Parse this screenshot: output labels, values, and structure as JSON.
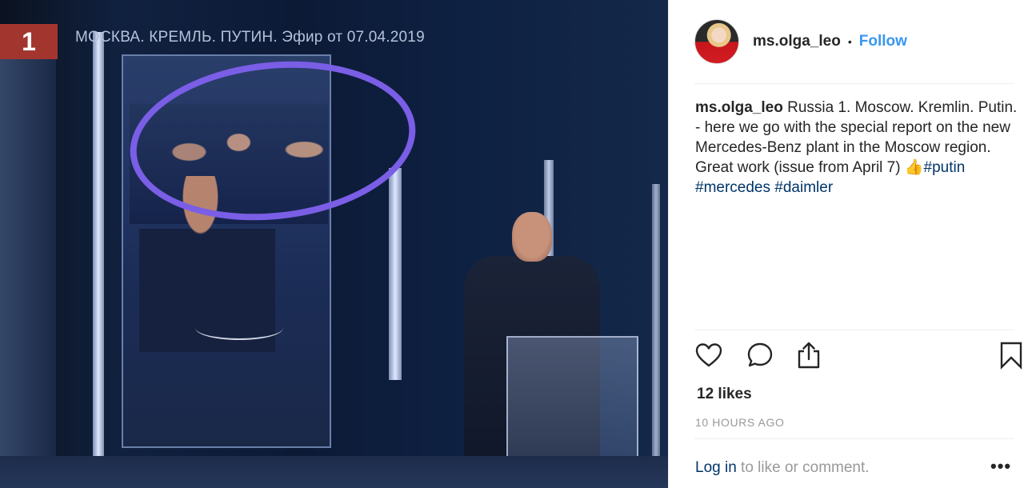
{
  "photo": {
    "channel_logo": "1",
    "tv_caption": "МОСКВА. КРЕМЛЬ. ПУТИН. Эфир от 07.04.2019",
    "annotation_color": "#7a5ee6"
  },
  "post": {
    "username": "ms.olga_leo",
    "separator": "•",
    "follow_label": "Follow",
    "caption": {
      "user": "ms.olga_leo",
      "text": " Russia 1. Moscow. Kremlin. Putin. - here we go with the special report on the new Mercedes-Benz plant in the Moscow region. Great work (issue from April 7) 👍",
      "hashtags": [
        "#putin",
        "#mercedes",
        "#daimler"
      ]
    },
    "actions": {
      "like_icon": "heart-icon",
      "comment_icon": "comment-bubble-icon",
      "share_icon": "share-upload-icon",
      "save_icon": "bookmark-icon"
    },
    "likes": "12 likes",
    "timestamp": "10 HOURS AGO",
    "footer": {
      "login_label": "Log in",
      "rest_label": " to like or comment."
    },
    "more_label": "•••"
  },
  "colors": {
    "accent": "#3897f0",
    "link": "#003569",
    "muted": "#999999",
    "text": "#262626"
  }
}
